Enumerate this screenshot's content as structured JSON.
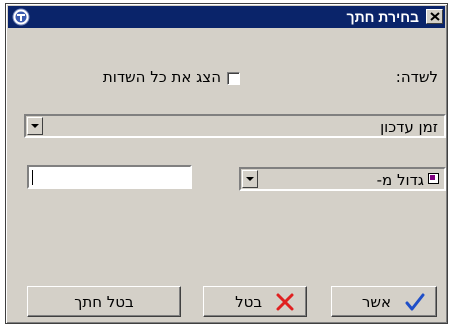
{
  "window": {
    "title": "בחירת חתך",
    "close_icon": "close-x-icon",
    "app_icon": "app-logo-icon"
  },
  "field": {
    "label": "לשדה:",
    "show_all_label": "הצג את כל השדות",
    "show_all_checked": false,
    "selected_value": "זמן עדכון"
  },
  "condition": {
    "selected_value": "גדול מ-",
    "operator_icon": "purple-square-icon",
    "value": ""
  },
  "buttons": {
    "ok_label": "אשר",
    "cancel_label": "בטל",
    "cancel_slice_label": "בטל חתך"
  },
  "colors": {
    "titlebar": "#0a246a",
    "ok_check": "#1f4fc8",
    "cancel_x": "#e02020",
    "operator_square": "#800080"
  }
}
